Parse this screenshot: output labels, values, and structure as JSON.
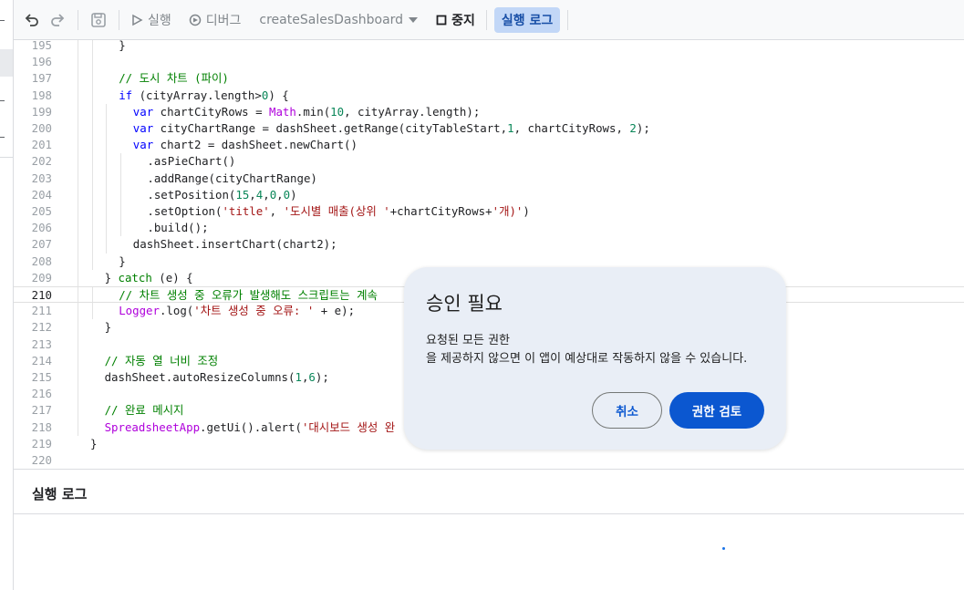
{
  "toolbar": {
    "undo_icon": "undo-icon",
    "redo_icon": "redo-icon",
    "save_icon": "save-icon",
    "run_label": "실행",
    "debug_label": "디버그",
    "function_name": "createSalesDashboard",
    "stop_label": "중지",
    "exec_log_label": "실행 로그"
  },
  "log_panel": {
    "title": "실행 로그"
  },
  "dialog": {
    "title": "승인 필요",
    "line1": "요청된 모든 권한",
    "line2": "을 제공하지 않으면 이 앱이 예상대로 작동하지 않을 수 있습니다.",
    "cancel_label": "취소",
    "review_label": "권한 검토"
  },
  "code": {
    "current_line": "210",
    "lines": [
      {
        "n": "195",
        "indent": 2,
        "tokens": [
          [
            "p",
            "}"
          ]
        ]
      },
      {
        "n": "196",
        "indent": 0,
        "tokens": []
      },
      {
        "n": "197",
        "indent": 2,
        "tokens": [
          [
            "com",
            "// 도시 차트 (파이)"
          ]
        ]
      },
      {
        "n": "198",
        "indent": 2,
        "tokens": [
          [
            "kw",
            "if"
          ],
          [
            "p",
            " (cityArray.length>"
          ],
          [
            "num",
            "0"
          ],
          [
            "p",
            ") {"
          ]
        ]
      },
      {
        "n": "199",
        "indent": 3,
        "tokens": [
          [
            "kw",
            "var"
          ],
          [
            "p",
            " chartCityRows = "
          ],
          [
            "fn",
            "Math"
          ],
          [
            "p",
            ".min("
          ],
          [
            "num",
            "10"
          ],
          [
            "p",
            ", cityArray.length);"
          ]
        ]
      },
      {
        "n": "200",
        "indent": 3,
        "tokens": [
          [
            "kw",
            "var"
          ],
          [
            "p",
            " cityChartRange = dashSheet.getRange(cityTableStart,"
          ],
          [
            "num",
            "1"
          ],
          [
            "p",
            ", chartCityRows, "
          ],
          [
            "num",
            "2"
          ],
          [
            "p",
            ");"
          ]
        ]
      },
      {
        "n": "201",
        "indent": 3,
        "tokens": [
          [
            "kw",
            "var"
          ],
          [
            "p",
            " chart2 = dashSheet.newChart()"
          ]
        ]
      },
      {
        "n": "202",
        "indent": 4,
        "tokens": [
          [
            "p",
            ".asPieChart()"
          ]
        ]
      },
      {
        "n": "203",
        "indent": 4,
        "tokens": [
          [
            "p",
            ".addRange(cityChartRange)"
          ]
        ]
      },
      {
        "n": "204",
        "indent": 4,
        "tokens": [
          [
            "p",
            ".setPosition("
          ],
          [
            "num",
            "15"
          ],
          [
            "p",
            ","
          ],
          [
            "num",
            "4"
          ],
          [
            "p",
            ","
          ],
          [
            "num",
            "0"
          ],
          [
            "p",
            ","
          ],
          [
            "num",
            "0"
          ],
          [
            "p",
            ")"
          ]
        ]
      },
      {
        "n": "205",
        "indent": 4,
        "tokens": [
          [
            "p",
            ".setOption("
          ],
          [
            "str",
            "'title'"
          ],
          [
            "p",
            ", "
          ],
          [
            "str",
            "'도시별 매출(상위 '"
          ],
          [
            "p",
            "+chartCityRows+"
          ],
          [
            "str",
            "'개)'"
          ],
          [
            "p",
            ")"
          ]
        ]
      },
      {
        "n": "206",
        "indent": 4,
        "tokens": [
          [
            "p",
            ".build();"
          ]
        ]
      },
      {
        "n": "207",
        "indent": 3,
        "tokens": [
          [
            "p",
            "dashSheet.insertChart(chart2);"
          ]
        ]
      },
      {
        "n": "208",
        "indent": 2,
        "tokens": [
          [
            "p",
            "}"
          ]
        ]
      },
      {
        "n": "209",
        "indent": 1,
        "tokens": [
          [
            "p",
            "} "
          ],
          [
            "kw2",
            "catch"
          ],
          [
            "p",
            " (e) {"
          ]
        ]
      },
      {
        "n": "210",
        "indent": 2,
        "tokens": [
          [
            "com",
            "// 차트 생성 중 오류가 발생해도 스크립트는 계속"
          ]
        ]
      },
      {
        "n": "211",
        "indent": 2,
        "tokens": [
          [
            "fn",
            "Logger"
          ],
          [
            "p",
            ".log("
          ],
          [
            "str",
            "'차트 생성 중 오류: '"
          ],
          [
            "p",
            " + e);"
          ]
        ]
      },
      {
        "n": "212",
        "indent": 1,
        "tokens": [
          [
            "p",
            "}"
          ]
        ]
      },
      {
        "n": "213",
        "indent": 0,
        "tokens": []
      },
      {
        "n": "214",
        "indent": 1,
        "tokens": [
          [
            "com",
            "// 자동 열 너비 조정"
          ]
        ]
      },
      {
        "n": "215",
        "indent": 1,
        "tokens": [
          [
            "p",
            "dashSheet.autoResizeColumns("
          ],
          [
            "num",
            "1"
          ],
          [
            "p",
            ","
          ],
          [
            "num",
            "6"
          ],
          [
            "p",
            ");"
          ]
        ]
      },
      {
        "n": "216",
        "indent": 0,
        "tokens": []
      },
      {
        "n": "217",
        "indent": 1,
        "tokens": [
          [
            "com",
            "// 완료 메시지"
          ]
        ]
      },
      {
        "n": "218",
        "indent": 1,
        "tokens": [
          [
            "fn",
            "SpreadsheetApp"
          ],
          [
            "p",
            ".getUi().alert("
          ],
          [
            "str",
            "'대시보드 생성 완"
          ]
        ]
      },
      {
        "n": "219",
        "indent": 0,
        "tokens": [
          [
            "p",
            "}"
          ]
        ]
      },
      {
        "n": "220",
        "indent": 0,
        "tokens": []
      }
    ]
  }
}
